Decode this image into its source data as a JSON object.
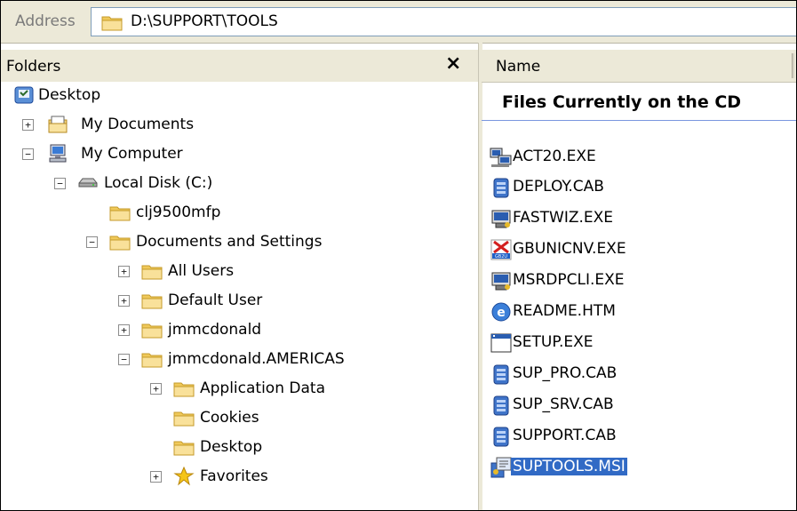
{
  "address": {
    "label": "Address",
    "path": "D:\\SUPPORT\\TOOLS"
  },
  "folders_pane": {
    "title": "Folders",
    "close_glyph": "×"
  },
  "tree": [
    {
      "label": "Desktop",
      "icon": "desktop-icon",
      "expander": "",
      "level": 0
    },
    {
      "label": "My Documents",
      "icon": "my-documents-icon",
      "expander": "+",
      "level": 1
    },
    {
      "label": "My Computer",
      "icon": "my-computer-icon",
      "expander": "−",
      "level": 1
    },
    {
      "label": "Local Disk (C:)",
      "icon": "local-disk-icon",
      "expander": "−",
      "level": 2
    },
    {
      "label": "clj9500mfp",
      "icon": "folder-icon",
      "expander": "",
      "level": 3
    },
    {
      "label": "Documents and Settings",
      "icon": "folder-icon",
      "expander": "−",
      "level": 3
    },
    {
      "label": "All Users",
      "icon": "folder-icon",
      "expander": "+",
      "level": 4
    },
    {
      "label": "Default User",
      "icon": "folder-icon",
      "expander": "+",
      "level": 4
    },
    {
      "label": "jmmcdonald",
      "icon": "folder-icon",
      "expander": "+",
      "level": 4
    },
    {
      "label": "jmmcdonald.AMERICAS",
      "icon": "folder-icon",
      "expander": "−",
      "level": 4
    },
    {
      "label": "Application Data",
      "icon": "folder-icon",
      "expander": "+",
      "level": 5
    },
    {
      "label": "Cookies",
      "icon": "folder-icon",
      "expander": "",
      "level": 5
    },
    {
      "label": "Desktop",
      "icon": "folder-icon",
      "expander": "",
      "level": 5
    },
    {
      "label": "Favorites",
      "icon": "favorites-star-icon",
      "expander": "+",
      "level": 5
    }
  ],
  "files_pane": {
    "column_name": "Name",
    "group_title": "Files Currently on the CD",
    "files": [
      {
        "name": "ACT20.EXE",
        "icon": "computers-app-icon",
        "selected": false
      },
      {
        "name": "DEPLOY.CAB",
        "icon": "cabinet-file-icon",
        "selected": false
      },
      {
        "name": "FASTWIZ.EXE",
        "icon": "wizard-app-icon",
        "selected": false
      },
      {
        "name": "GBUNICNV.EXE",
        "icon": "gb2u-converter-icon",
        "selected": false
      },
      {
        "name": "MSRDPCLI.EXE",
        "icon": "wizard-app-icon",
        "selected": false
      },
      {
        "name": "README.HTM",
        "icon": "html-document-icon",
        "selected": false
      },
      {
        "name": "SETUP.EXE",
        "icon": "application-window-icon",
        "selected": false
      },
      {
        "name": "SUP_PRO.CAB",
        "icon": "cabinet-file-icon",
        "selected": false
      },
      {
        "name": "SUP_SRV.CAB",
        "icon": "cabinet-file-icon",
        "selected": false
      },
      {
        "name": "SUPPORT.CAB",
        "icon": "cabinet-file-icon",
        "selected": false
      },
      {
        "name": "SUPTOOLS.MSI",
        "icon": "installer-package-icon",
        "selected": true
      }
    ]
  },
  "colors": {
    "chrome": "#ece9d8",
    "selection": "#316ac5",
    "folder": "#f5d87a"
  }
}
